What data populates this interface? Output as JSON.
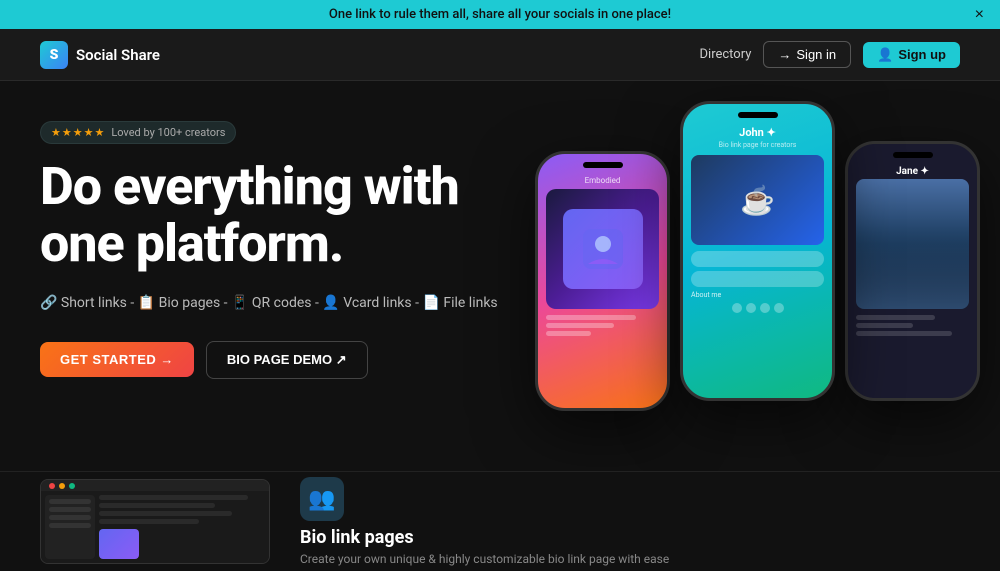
{
  "banner": {
    "text": "One link to rule them all, share all your socials in one place!",
    "close_label": "×"
  },
  "navbar": {
    "logo_letter": "S",
    "logo_name": "Social Share",
    "directory_label": "Directory",
    "signin_label": "Sign in",
    "signup_label": "Sign up",
    "signin_icon": "→",
    "signup_icon": "👤"
  },
  "hero": {
    "badge_stars": "★★★★★",
    "badge_label": "Loved by 100+ creators",
    "title_line1": "Do everything with",
    "title_line2": "one platform.",
    "features": "🔗 Short links -  📋 Bio pages -  📱 QR codes -  👤 Vcard links -  📄 File links",
    "cta_primary": "GET STARTED →",
    "cta_secondary": "BIO PAGE DEMO ↗",
    "phone_left_label": "Embodied",
    "phone_center_name": "John ✦",
    "phone_center_sub": "Bio link page for creators",
    "phone_right_name": "Jane ✦"
  },
  "bottom": {
    "bio_icon": "👥",
    "bio_title": "Bio link pages",
    "bio_desc": "Create your own unique & highly customizable bio link page with ease"
  },
  "colors": {
    "accent_cyan": "#1ecad3",
    "accent_orange": "#f97316",
    "bg_dark": "#111111",
    "navbar_bg": "#1a1a1a"
  }
}
